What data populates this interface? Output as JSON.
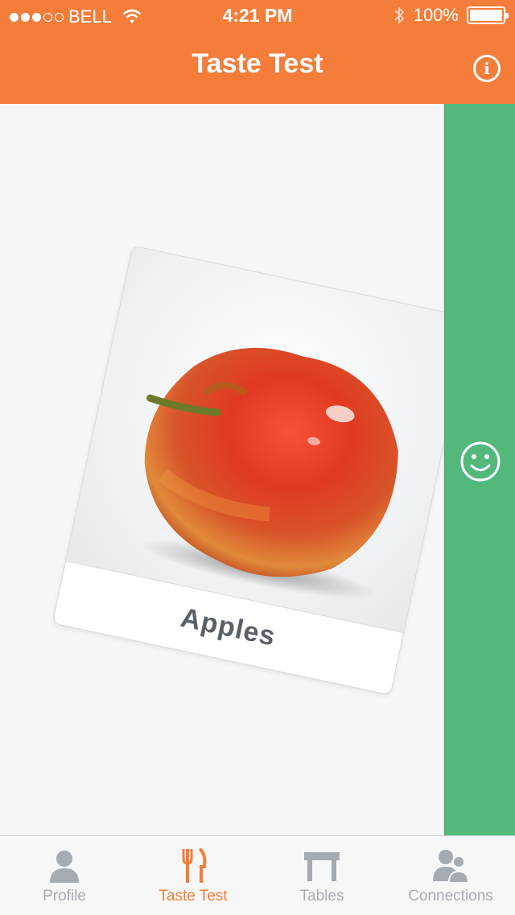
{
  "status_bar": {
    "carrier": "BELL",
    "time": "4:21 PM",
    "battery": "100%",
    "signal_strength": "3 of 5 dots"
  },
  "nav": {
    "title": "Taste Test",
    "info_icon": "info-icon"
  },
  "card": {
    "label": "Apples",
    "image": "red-apple-photo"
  },
  "back_card": {
    "image": "bananas-photo"
  },
  "like_panel": {
    "icon": "smile-icon",
    "color": "#52b87c"
  },
  "tabs": [
    {
      "label": "Profile",
      "icon": "person-icon",
      "active": false
    },
    {
      "label": "Taste Test",
      "icon": "fork-knife-icon",
      "active": true
    },
    {
      "label": "Tables",
      "icon": "table-icon",
      "active": false
    },
    {
      "label": "Connections",
      "icon": "people-icon",
      "active": false
    }
  ],
  "colors": {
    "accent": "#f47d3a",
    "inactive_tab": "#a6abb2",
    "background": "#f5f6f8"
  }
}
